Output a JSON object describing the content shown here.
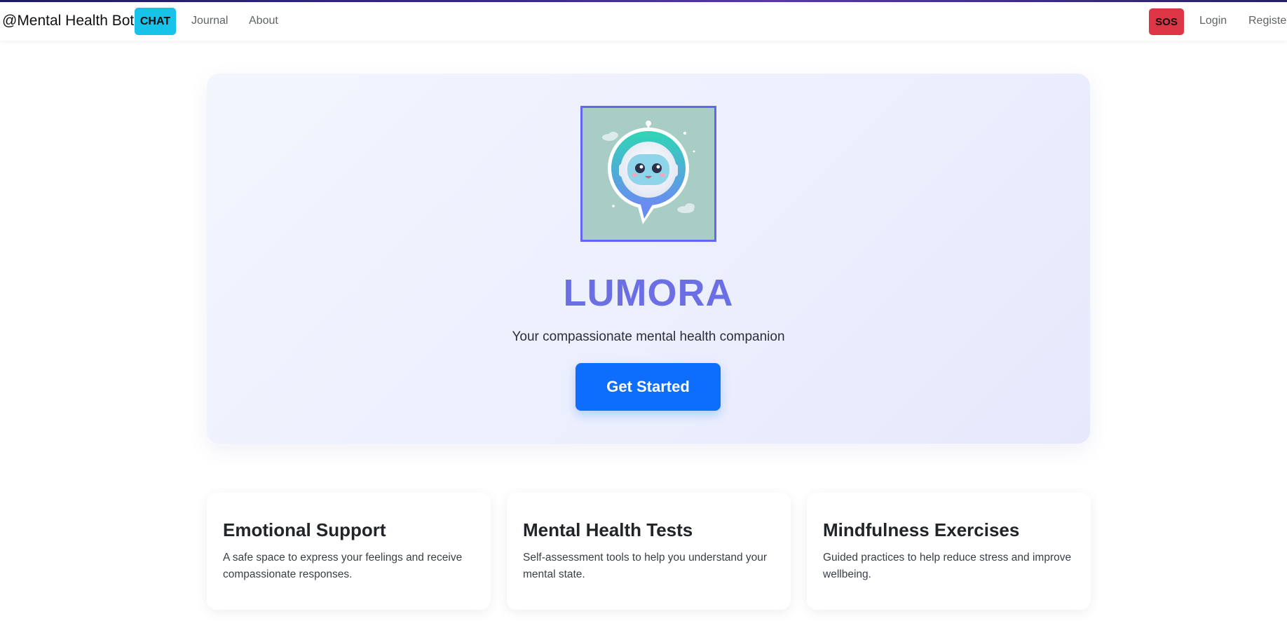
{
  "navbar": {
    "brand": "@Mental Health Bot",
    "chat_label": "CHAT",
    "journal_label": "Journal",
    "about_label": "About",
    "sos_label": "SOS",
    "login_label": "Login",
    "register_label": "Registe"
  },
  "hero": {
    "mascot_icon": "robot-mascot-icon",
    "title": "LUMORA",
    "subtitle": "Your compassionate mental health companion",
    "cta_label": "Get Started"
  },
  "features": [
    {
      "title": "Emotional Support",
      "text": "A safe space to express your feelings and receive compassionate responses."
    },
    {
      "title": "Mental Health Tests",
      "text": "Self-assessment tools to help you understand your mental state."
    },
    {
      "title": "Mindfulness Exercises",
      "text": "Guided practices to help reduce stress and improve wellbeing."
    }
  ],
  "colors": {
    "chat_button": "#17c3e8",
    "sos_button": "#dc3545",
    "cta_button": "#0d6efd",
    "title_accent": "#6b6fe3",
    "frame_border": "#6366f1"
  }
}
